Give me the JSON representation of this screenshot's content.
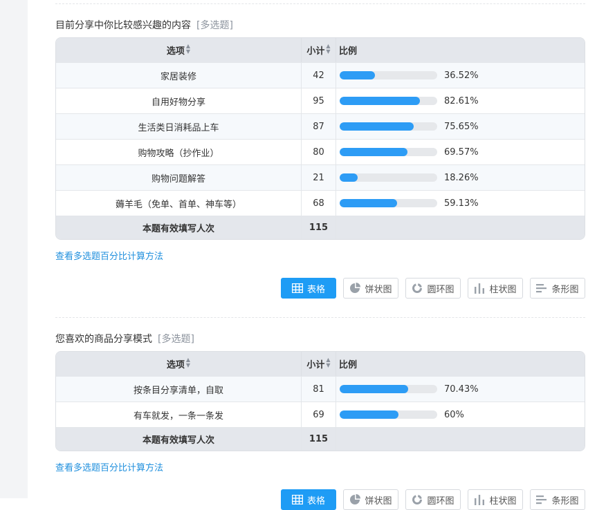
{
  "questions": [
    {
      "title": "目前分享中你比较感兴趣的内容",
      "tag": "[多选题]",
      "headers": {
        "option": "选项",
        "count": "小计",
        "ratio": "比例"
      },
      "rows": [
        {
          "option": "家居装修",
          "count": "42",
          "percent": 36.52,
          "percent_label": "36.52%"
        },
        {
          "option": "自用好物分享",
          "count": "95",
          "percent": 82.61,
          "percent_label": "82.61%"
        },
        {
          "option": "生活类日消耗品上车",
          "count": "87",
          "percent": 75.65,
          "percent_label": "75.65%"
        },
        {
          "option": "购物攻略（抄作业）",
          "count": "80",
          "percent": 69.57,
          "percent_label": "69.57%"
        },
        {
          "option": "购物问题解答",
          "count": "21",
          "percent": 18.26,
          "percent_label": "18.26%"
        },
        {
          "option": "薅羊毛（免单、首单、神车等）",
          "count": "68",
          "percent": 59.13,
          "percent_label": "59.13%"
        }
      ],
      "total_label": "本题有效填写人次",
      "total_count": "115",
      "calc_link": "查看多选题百分比计算方法"
    },
    {
      "title": "您喜欢的商品分享模式",
      "tag": "[多选题]",
      "headers": {
        "option": "选项",
        "count": "小计",
        "ratio": "比例"
      },
      "rows": [
        {
          "option": "按条目分享清单，自取",
          "count": "81",
          "percent": 70.43,
          "percent_label": "70.43%"
        },
        {
          "option": "有车就发，一条一条发",
          "count": "69",
          "percent": 60,
          "percent_label": "60%"
        }
      ],
      "total_label": "本题有效填写人次",
      "total_count": "115",
      "calc_link": "查看多选题百分比计算方法"
    }
  ],
  "toolbar": {
    "table": "表格",
    "pie": "饼状图",
    "ring": "圆环图",
    "column": "柱状图",
    "bar": "条形图"
  },
  "colors": {
    "accent": "#1e9cf5",
    "bar_fill": "#2d9cf5",
    "bar_track": "#e6e8eb",
    "header_bg": "#e4e7ec",
    "link": "#1f8fdd"
  }
}
